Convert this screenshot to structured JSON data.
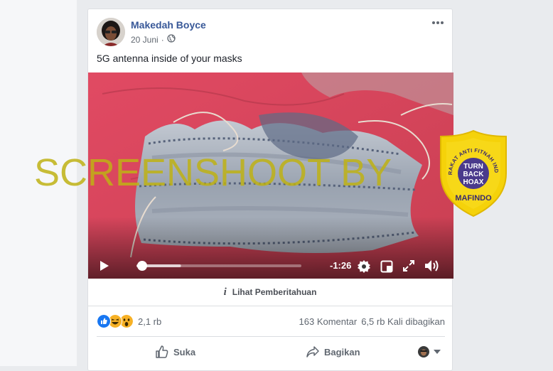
{
  "post": {
    "author": "Makedah Boyce",
    "date": "20 Juni",
    "separator": "·",
    "privacy_icon": "globe-icon",
    "more_icon": "more-options-icon",
    "text": "5G antenna inside of your masks"
  },
  "video": {
    "time_remaining": "-1:26",
    "progress": 0.0,
    "buffered": 0.27,
    "icons": [
      "play-icon",
      "settings-icon",
      "mini-player-icon",
      "fullscreen-icon",
      "volume-icon"
    ]
  },
  "info_bar": {
    "label": "Lihat Pemberitahuan",
    "icon": "info-icon"
  },
  "stats": {
    "reaction_icons": [
      "like-icon",
      "haha-icon",
      "wow-icon"
    ],
    "reaction_count": "2,1 rb",
    "comments": "163 Komentar",
    "shares": "6,5 rb Kali dibagikan"
  },
  "actions": {
    "like": "Suka",
    "share": "Bagikan"
  },
  "watermark": {
    "text": "SCREENSHOOT BY"
  },
  "badge": {
    "top_text": "MASYARAKAT ANTI FITNAH INDONESIA",
    "center_lines": [
      "TURN",
      "BACK",
      "HOAX"
    ],
    "bottom_text": "MAFINDO"
  },
  "colors": {
    "link": "#385898",
    "background": "#e9ebee",
    "badge_yellow": "#f5d20a",
    "badge_purple": "#4a3a8c"
  }
}
